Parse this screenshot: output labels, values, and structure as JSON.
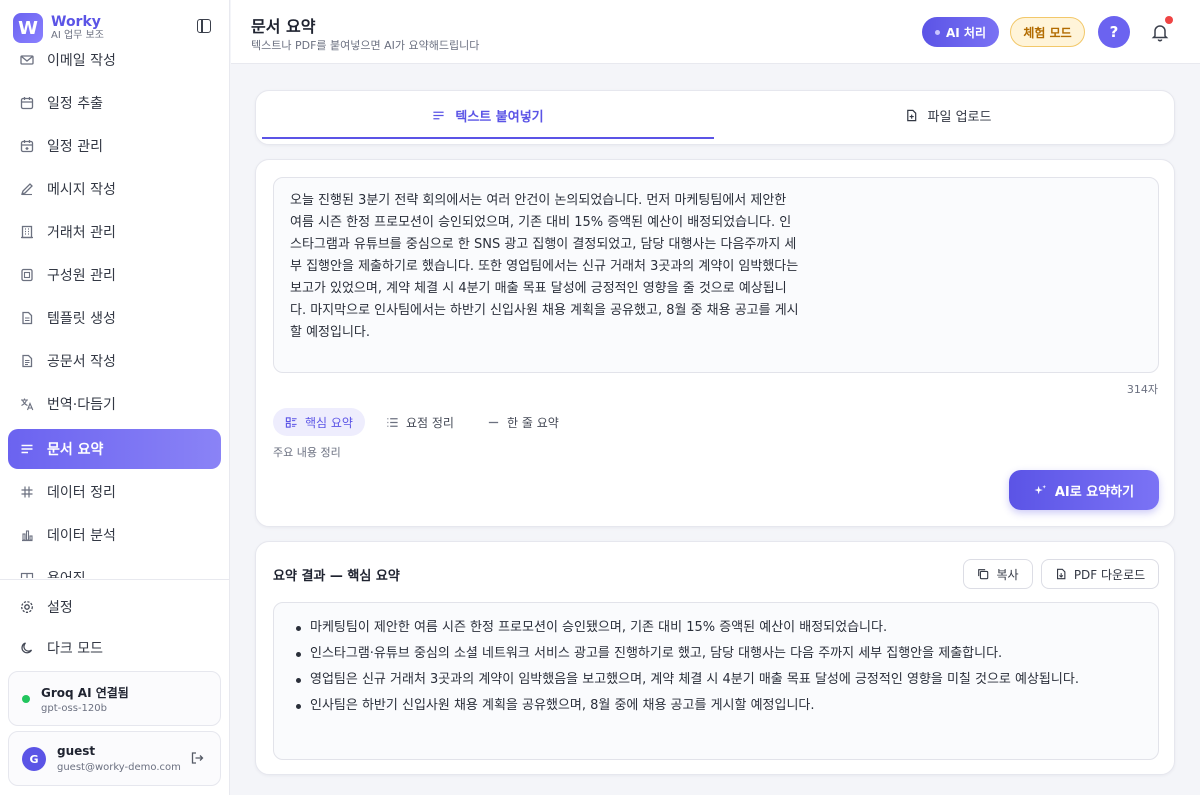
{
  "brand": {
    "name": "Worky",
    "subtitle": "AI 업무 보조",
    "logo_letter": "W"
  },
  "sidebar": {
    "items": [
      {
        "label": "이메일 작성",
        "icon": "mail-icon"
      },
      {
        "label": "일정 추출",
        "icon": "calendar-icon"
      },
      {
        "label": "일정 관리",
        "icon": "calendar-check-icon"
      },
      {
        "label": "메시지 작성",
        "icon": "pencil-icon"
      },
      {
        "label": "거래처 관리",
        "icon": "building-icon"
      },
      {
        "label": "구성원 관리",
        "icon": "id-card-icon"
      },
      {
        "label": "템플릿 생성",
        "icon": "file-icon"
      },
      {
        "label": "공문서 작성",
        "icon": "file-text-icon"
      },
      {
        "label": "번역·다듬기",
        "icon": "translate-icon"
      },
      {
        "label": "문서 요약",
        "icon": "align-left-icon",
        "active": true
      },
      {
        "label": "데이터 정리",
        "icon": "hash-icon"
      },
      {
        "label": "데이터 분석",
        "icon": "bar-chart-icon"
      },
      {
        "label": "용어집",
        "icon": "book-icon"
      }
    ],
    "settings_label": "설정",
    "dark_mode_label": "다크 모드",
    "status": {
      "title": "Groq AI 연결됨",
      "model": "gpt-oss-120b",
      "color": "#22c55e"
    },
    "user": {
      "initial": "G",
      "name": "guest",
      "email": "guest@worky-demo.com"
    }
  },
  "header": {
    "title": "문서 요약",
    "subtitle": "텍스트나 PDF를 붙여넣으면 AI가 요약해드립니다",
    "ai_badge": "AI 처리",
    "trial_badge": "체험 모드",
    "help_label": "?"
  },
  "tabs": [
    {
      "label": "텍스트 붙여넣기",
      "active": true
    },
    {
      "label": "파일 업로드",
      "active": false
    }
  ],
  "input": {
    "text": "오늘 진행된 3분기 전략 회의에서는 여러 안건이 논의되었습니다. 먼저 마케팅팀에서 제안한 여름 시즌 한정 프로모션이 승인되었으며, 기존 대비 15% 증액된 예산이 배정되었습니다. 인스타그램과 유튜브를 중심으로 한 SNS 광고 집행이 결정되었고, 담당 대행사는 다음주까지 세부 집행안을 제출하기로 했습니다. 또한 영업팀에서는 신규 거래처 3곳과의 계약이 임박했다는 보고가 있었으며, 계약 체결 시 4분기 매출 목표 달성에 긍정적인 영향을 줄 것으로 예상됩니다. 마지막으로 인사팀에서는 하반기 신입사원 채용 계획을 공유했고, 8월 중 채용 공고를 게시할 예정입니다.",
    "char_count": "314자",
    "modes": [
      {
        "label": "핵심 요약",
        "active": true
      },
      {
        "label": "요점 정리",
        "active": false
      },
      {
        "label": "한 줄 요약",
        "active": false
      }
    ],
    "mode_description": "주요 내용 정리",
    "submit_label": "AI로 요약하기"
  },
  "result": {
    "title": "요약 결과 — 핵심 요약",
    "copy_label": "복사",
    "pdf_label": "PDF 다운로드",
    "bullets": [
      "마케팅팀이 제안한 여름 시즌 한정 프로모션이 승인됐으며, 기존 대비 15% 증액된 예산이 배정되었습니다.",
      "인스타그램·유튜브 중심의 소셜 네트워크 서비스 광고를 진행하기로 했고, 담당 대행사는 다음 주까지 세부 집행안을 제출합니다.",
      "영업팀은 신규 거래처 3곳과의 계약이 임박했음을 보고했으며, 계약 체결 시 4분기 매출 목표 달성에 긍정적인 영향을 미칠 것으로 예상됩니다.",
      "인사팀은 하반기 신입사원 채용 계획을 공유했으며, 8월 중에 채용 공고를 게시할 예정입니다."
    ]
  },
  "colors": {
    "accent": "#5b54e6",
    "trial_bg": "#fff4d9",
    "trial_text": "#b26b00",
    "notify": "#ef4444"
  }
}
